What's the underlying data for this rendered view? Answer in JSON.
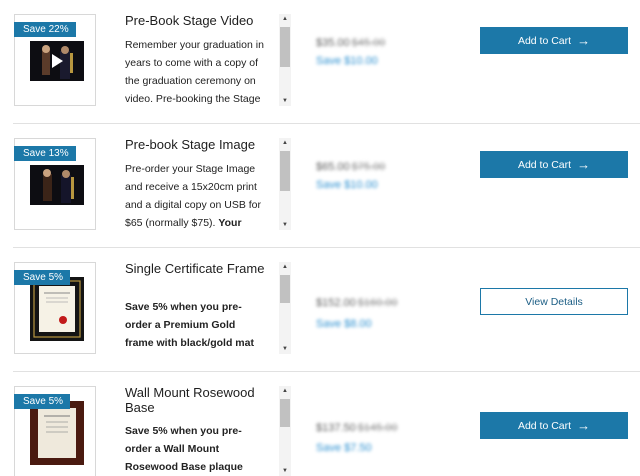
{
  "products": [
    {
      "badge": "Save 22%",
      "title": "Pre-Book Stage Video",
      "description": "Remember your graduation in years to come with a copy of the graduation ceremony on video. Pre-booking the Stage",
      "price": "$35.00",
      "old_price": "$45.00",
      "saving": "Save $10.00",
      "button": "Add to Cart",
      "image_icon": "graduation-video-thumbnail"
    },
    {
      "badge": "Save 13%",
      "title": "Pre-book Stage Image",
      "description": "Pre-order your Stage Image and receive a 15x20cm print and a digital copy on USB for $65 (normally $75).",
      "description_bold": "Your",
      "price": "$65.00",
      "old_price": "$75.00",
      "saving": "Save $10.00",
      "button": "Add to Cart",
      "image_icon": "graduation-photo-thumbnail"
    },
    {
      "badge": "Save 5%",
      "title": "Single Certificate Frame",
      "description_bold": "Save 5% when you pre-order a Premium Gold frame with black/gold mat",
      "price": "$152.00",
      "old_price": "$160.00",
      "saving": "Save $8.00",
      "button": "View Details",
      "image_icon": "certificate-frame-thumbnail"
    },
    {
      "badge": "Save 5%",
      "title": "Wall Mount Rosewood Base",
      "description_bold": "Save 5% when you pre-order a Wall Mount Rosewood Base plaque",
      "price": "$137.50",
      "old_price": "$145.00",
      "saving": "Save $7.50",
      "button": "Add to Cart",
      "image_icon": "rosewood-plaque-thumbnail"
    }
  ],
  "colors": {
    "accent": "#1c78a8",
    "saving_text": "#2a8fd0",
    "divider": "#e1e1e1"
  }
}
